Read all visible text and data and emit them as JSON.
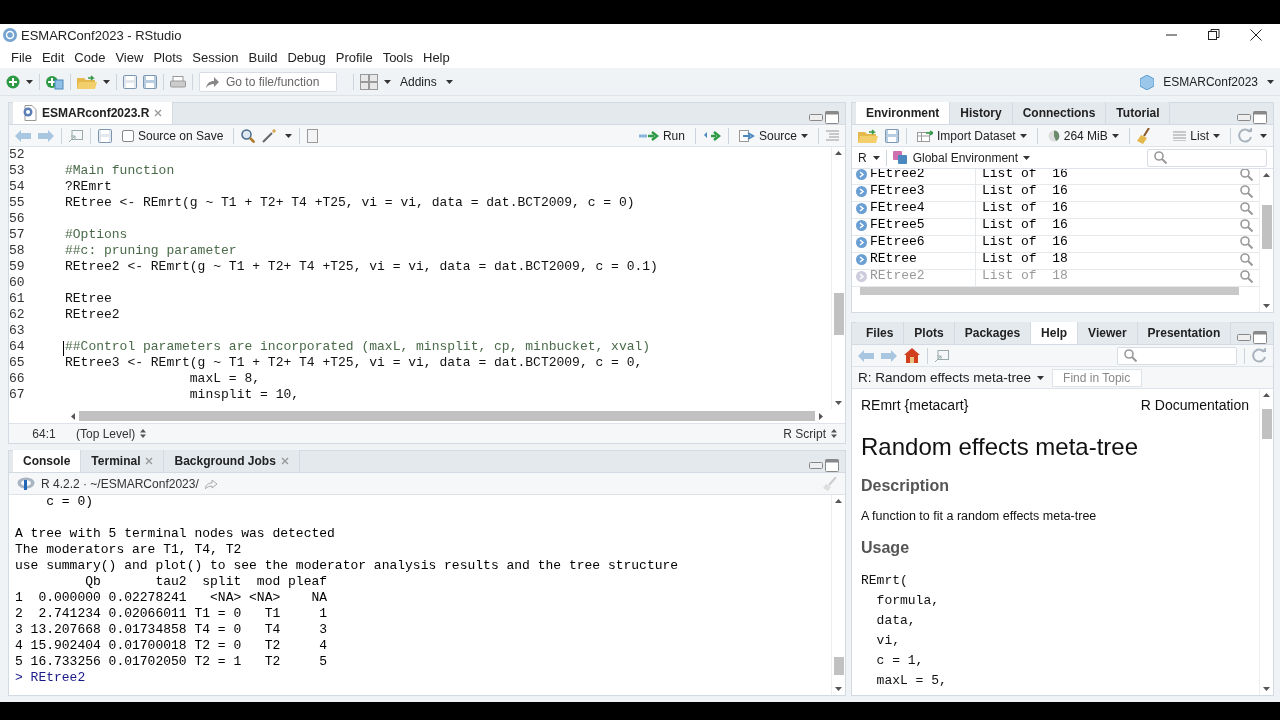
{
  "window": {
    "title": "ESMARConf2023 - RStudio"
  },
  "menu": [
    "File",
    "Edit",
    "Code",
    "View",
    "Plots",
    "Session",
    "Build",
    "Debug",
    "Profile",
    "Tools",
    "Help"
  ],
  "toolbar": {
    "goto_placeholder": "Go to file/function",
    "addins": "Addins",
    "project": "ESMARConf2023"
  },
  "editor": {
    "tabs": [
      {
        "label": "ESMARconf2023.R",
        "selected": true
      }
    ],
    "source_on_save": {
      "label": "Source on Save",
      "checked": false
    },
    "run": "Run",
    "source": "Source",
    "lines": [
      {
        "number": "52"
      },
      {
        "number": "53",
        "text": "#Main function",
        "kind": "comment"
      },
      {
        "number": "54",
        "text": "?REmrt",
        "kind": "code"
      },
      {
        "number": "55",
        "text": "REtree <- REmrt(g ~ T1 + T2+ T4 +T25, vi = vi, data = dat.BCT2009, c = 0)",
        "kind": "code"
      },
      {
        "number": "56"
      },
      {
        "number": "57",
        "text": "#Options",
        "kind": "comment"
      },
      {
        "number": "58",
        "text": "##c: pruning parameter",
        "kind": "comment"
      },
      {
        "number": "59",
        "text": "REtree2 <- REmrt(g ~ T1 + T2+ T4 +T25, vi = vi, data = dat.BCT2009, c = 0.1)",
        "kind": "code"
      },
      {
        "number": "60"
      },
      {
        "number": "61",
        "text": "REtree",
        "kind": "code"
      },
      {
        "number": "62",
        "text": "REtree2",
        "kind": "code"
      },
      {
        "number": "63"
      },
      {
        "number": "64",
        "text": "##Control parameters are incorporated (maxL, minsplit, cp, minbucket, xval)",
        "kind": "comment"
      },
      {
        "number": "65",
        "text": "REtree3 <- REmrt(g ~ T1 + T2+ T4 +T25, vi = vi, data = dat.BCT2009, c = 0,",
        "kind": "code"
      },
      {
        "number": "66",
        "text": "                maxL = 8,",
        "kind": "code"
      },
      {
        "number": "67",
        "text": "                minsplit = 10,",
        "kind": "code"
      }
    ],
    "status": {
      "position": "64:1",
      "scope": "(Top Level)",
      "file_type": "R Script"
    }
  },
  "console": {
    "tabs": [
      {
        "label": "Console",
        "selected": true
      },
      {
        "label": "Terminal",
        "selected": false
      },
      {
        "label": "Background Jobs",
        "selected": false
      }
    ],
    "path": "R 4.2.2 · ~/ESMARConf2023/",
    "lines": [
      {
        "text": "    c = 0)",
        "kind": "continuation"
      },
      {
        "text": "A tree with 5 terminal nodes was detected",
        "kind": "output"
      },
      {
        "text": "The moderators are T1, T4, T2",
        "kind": "output"
      },
      {
        "text": "use summary() and plot() to see the moderator analysis results and the tree structure",
        "kind": "output"
      },
      {
        "text": "         Qb       tau2  split  mod pleaf",
        "kind": "output"
      },
      {
        "text": "1  0.000000 0.02278241   <NA> <NA>    NA",
        "kind": "output"
      },
      {
        "text": "2  2.741234 0.02066011 T1 = 0   T1     1",
        "kind": "output"
      },
      {
        "text": "3 13.207668 0.01734858 T4 = 0   T4     3",
        "kind": "output"
      },
      {
        "text": "4 15.902404 0.01700018 T2 = 0   T2     4",
        "kind": "output"
      },
      {
        "text": "5 16.733256 0.01702050 T2 = 1   T2     5",
        "kind": "output"
      },
      {
        "text": "> REtree2",
        "kind": "input"
      }
    ]
  },
  "environment": {
    "tabs": [
      {
        "label": "Environment",
        "selected": true
      },
      {
        "label": "History",
        "selected": false
      },
      {
        "label": "Connections",
        "selected": false
      },
      {
        "label": "Tutorial",
        "selected": false
      }
    ],
    "import": "Import Dataset",
    "memory": "264 MiB",
    "view": "List",
    "language": "R",
    "scope": "Global Environment",
    "rows": [
      {
        "name": "FEtree2",
        "value": "List of  16"
      },
      {
        "name": "FEtree3",
        "value": "List of  16"
      },
      {
        "name": "FEtree4",
        "value": "List of  16"
      },
      {
        "name": "FEtree5",
        "value": "List of  16"
      },
      {
        "name": "FEtree6",
        "value": "List of  16"
      },
      {
        "name": "REtree",
        "value": "List of  18"
      },
      {
        "name": "REtree2",
        "value": "List of  18"
      }
    ]
  },
  "help": {
    "tabs": [
      {
        "label": "Files",
        "selected": false
      },
      {
        "label": "Plots",
        "selected": false
      },
      {
        "label": "Packages",
        "selected": false
      },
      {
        "label": "Help",
        "selected": true
      },
      {
        "label": "Viewer",
        "selected": false
      },
      {
        "label": "Presentation",
        "selected": false
      }
    ],
    "topic": "R: Random effects meta-tree",
    "find_placeholder": "Find in Topic",
    "doc": {
      "header_left": "REmrt {metacart}",
      "header_right": "R Documentation",
      "title": "Random effects meta-tree",
      "sections": [
        {
          "heading": "Description",
          "kind": "text",
          "body": [
            "A function to fit a random effects meta-tree"
          ]
        },
        {
          "heading": "Usage",
          "kind": "code",
          "body": [
            "REmrt(",
            "  formula,",
            "  data,",
            "  vi,",
            "  c = 1,",
            "  maxL = 5,"
          ]
        }
      ]
    }
  }
}
